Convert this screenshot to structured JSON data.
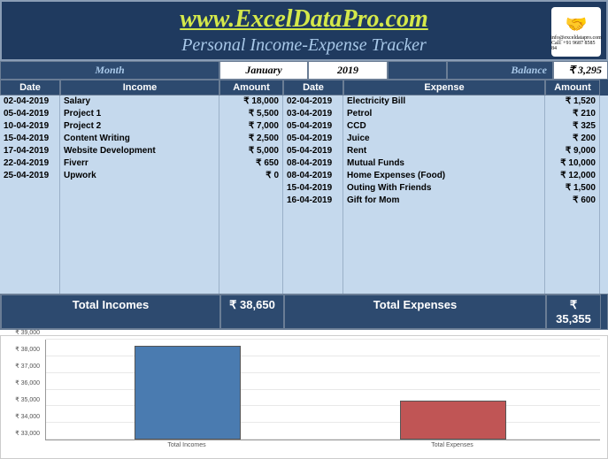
{
  "header": {
    "site_title": "www.ExcelDataPro.com",
    "subtitle": "Personal Income-Expense Tracker",
    "logo_email": "info@exceldatapro.com",
    "logo_phone": "Call: +91 9687 8585 84"
  },
  "period": {
    "month_label": "Month",
    "month_name": "January",
    "year": "2019",
    "balance_label": "Balance",
    "balance_value": "₹ 3,295"
  },
  "columns": {
    "date": "Date",
    "income": "Income",
    "amount": "Amount",
    "date2": "Date",
    "expense": "Expense",
    "amount2": "Amount"
  },
  "incomes": [
    {
      "date": "02-04-2019",
      "desc": "Salary",
      "amount": "₹ 18,000"
    },
    {
      "date": "05-04-2019",
      "desc": "Project 1",
      "amount": "₹ 5,500"
    },
    {
      "date": "10-04-2019",
      "desc": "Project 2",
      "amount": "₹ 7,000"
    },
    {
      "date": "15-04-2019",
      "desc": "Content Writing",
      "amount": "₹ 2,500"
    },
    {
      "date": "17-04-2019",
      "desc": "Website Development",
      "amount": "₹ 5,000"
    },
    {
      "date": "22-04-2019",
      "desc": "Fiverr",
      "amount": "₹ 650"
    },
    {
      "date": "25-04-2019",
      "desc": "Upwork",
      "amount": "₹ 0"
    }
  ],
  "expenses": [
    {
      "date": "02-04-2019",
      "desc": "Electricity Bill",
      "amount": "₹ 1,520"
    },
    {
      "date": "03-04-2019",
      "desc": "Petrol",
      "amount": "₹ 210"
    },
    {
      "date": "05-04-2019",
      "desc": "CCD",
      "amount": "₹ 325"
    },
    {
      "date": "05-04-2019",
      "desc": "Juice",
      "amount": "₹ 200"
    },
    {
      "date": "05-04-2019",
      "desc": "Rent",
      "amount": "₹ 9,000"
    },
    {
      "date": "08-04-2019",
      "desc": "Mutual Funds",
      "amount": "₹ 10,000"
    },
    {
      "date": "08-04-2019",
      "desc": "Home Expenses (Food)",
      "amount": "₹ 12,000"
    },
    {
      "date": "15-04-2019",
      "desc": "Outing With Friends",
      "amount": "₹ 1,500"
    },
    {
      "date": "16-04-2019",
      "desc": "Gift for Mom",
      "amount": "₹ 600"
    }
  ],
  "totals": {
    "income_label": "Total Incomes",
    "income_amount": "₹ 38,650",
    "expense_label": "Total Expenses",
    "expense_amount": "₹ 35,355"
  },
  "chart_data": {
    "type": "bar",
    "categories": [
      "Total Incomes",
      "Total Expenses"
    ],
    "values": [
      38650,
      35355
    ],
    "colors": [
      "#4a7bb0",
      "#c05555"
    ],
    "yticks": [
      "₹ 33,000",
      "₹ 34,000",
      "₹ 35,000",
      "₹ 36,000",
      "₹ 37,000",
      "₹ 38,000",
      "₹ 39,000"
    ],
    "ylim": [
      33000,
      39000
    ],
    "xlabel": "",
    "ylabel": ""
  }
}
